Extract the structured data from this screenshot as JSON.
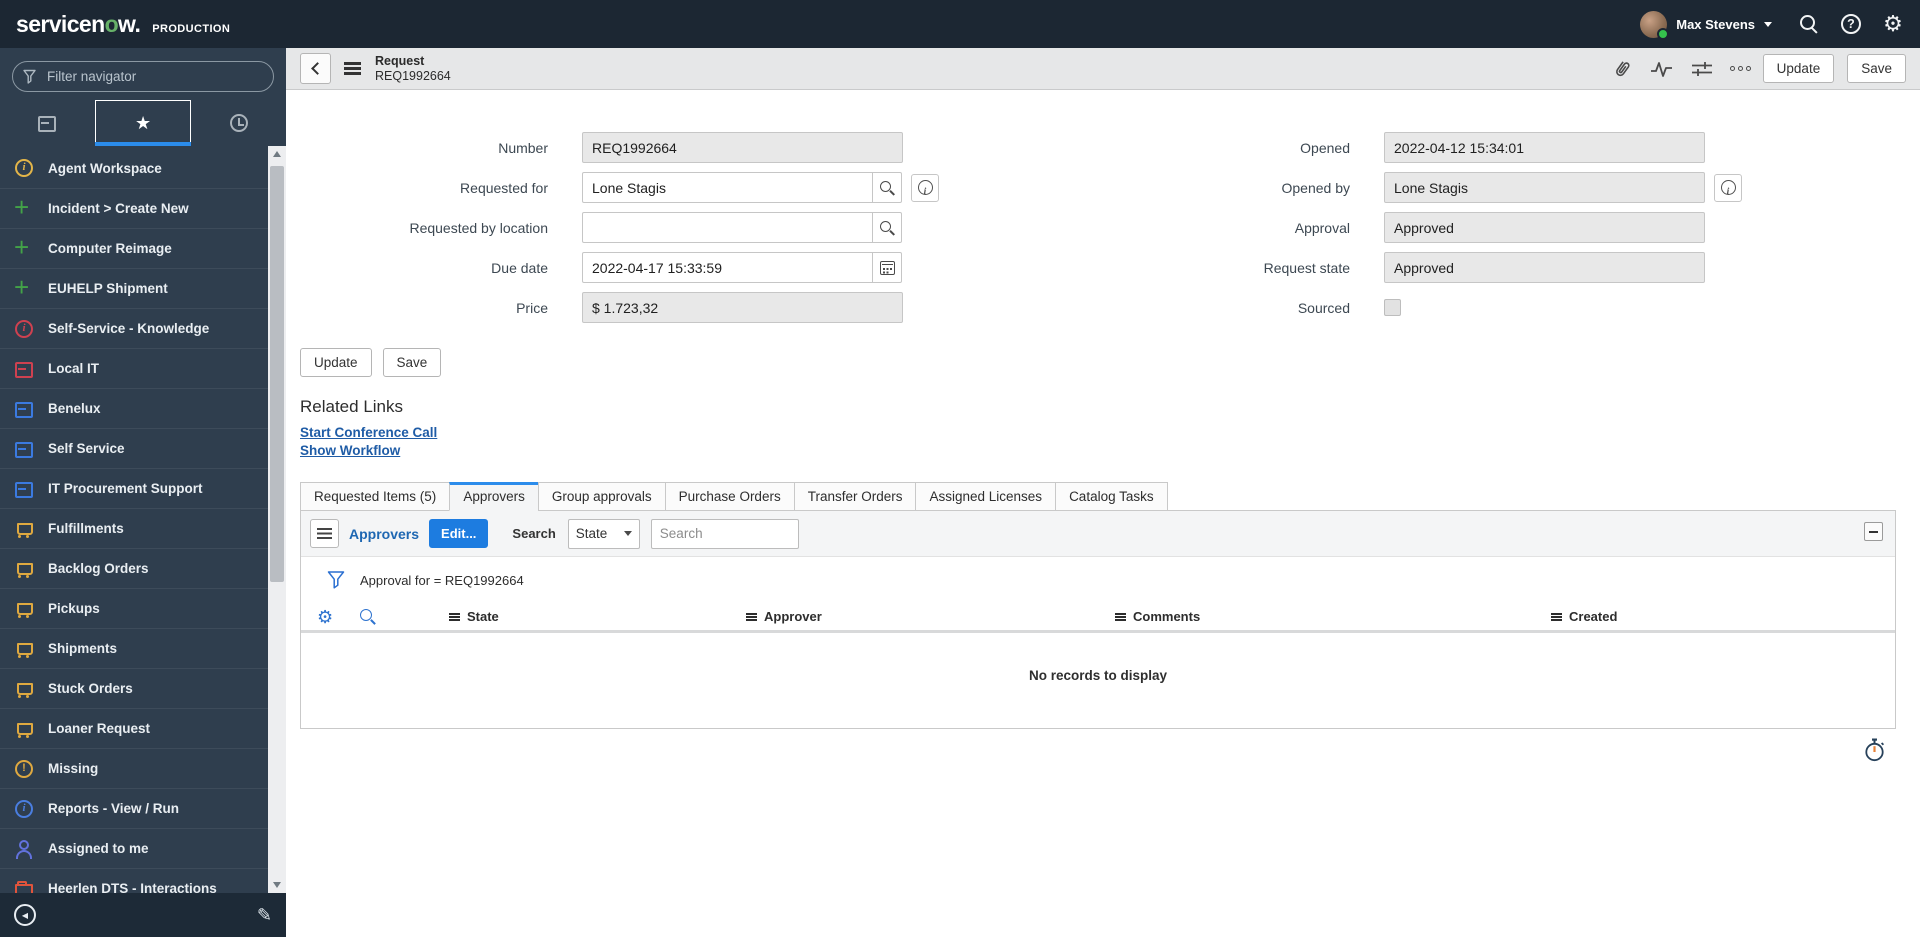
{
  "banner": {
    "brand_prefix": "servicen",
    "brand_accent": "o",
    "brand_suffix": "w.",
    "environment": "PRODUCTION",
    "user_name": "Max Stevens",
    "accent_green": "#67b168"
  },
  "sidebar": {
    "filter_placeholder": "Filter navigator",
    "items": [
      {
        "label": "Agent Workspace",
        "icon": "info-circle-icon",
        "color": "#e3b549"
      },
      {
        "label": "Incident > Create New",
        "icon": "plus-icon",
        "color": "#43a348"
      },
      {
        "label": "Computer Reimage",
        "icon": "plus-icon",
        "color": "#43a348"
      },
      {
        "label": "EUHELP Shipment",
        "icon": "plus-icon",
        "color": "#43a348"
      },
      {
        "label": "Self-Service - Knowledge",
        "icon": "info-circle-icon",
        "color": "#cf4150"
      },
      {
        "label": "Local IT",
        "icon": "box-icon",
        "color": "#cf4150"
      },
      {
        "label": "Benelux",
        "icon": "box-icon",
        "color": "#3b7ae0"
      },
      {
        "label": "Self Service",
        "icon": "box-icon",
        "color": "#3b7ae0"
      },
      {
        "label": "IT Procurement Support",
        "icon": "box-icon",
        "color": "#3b7ae0"
      },
      {
        "label": "Fulfillments",
        "icon": "cart-icon",
        "color": "#dfa940"
      },
      {
        "label": "Backlog Orders",
        "icon": "cart-icon",
        "color": "#dfa940"
      },
      {
        "label": "Pickups",
        "icon": "cart-icon",
        "color": "#dfa940"
      },
      {
        "label": "Shipments",
        "icon": "cart-icon",
        "color": "#dfa940"
      },
      {
        "label": "Stuck Orders",
        "icon": "cart-icon",
        "color": "#dfa940"
      },
      {
        "label": "Loaner Request",
        "icon": "cart-icon",
        "color": "#dfa940"
      },
      {
        "label": "Missing",
        "icon": "exclamation-circle-icon",
        "color": "#dfa940"
      },
      {
        "label": "Reports - View / Run",
        "icon": "info-circle-icon",
        "color": "#4a7ee0"
      },
      {
        "label": "Assigned to me",
        "icon": "person-icon",
        "color": "#6272dd"
      },
      {
        "label": "Heerlen DTS - Interactions",
        "icon": "folder-icon",
        "color": "#e0543c"
      }
    ]
  },
  "form_header": {
    "record_type": "Request",
    "record_number": "REQ1992664",
    "update_label": "Update",
    "save_label": "Save"
  },
  "form": {
    "left": [
      {
        "label": "Number",
        "value": "REQ1992664"
      },
      {
        "label": "Requested for",
        "value": "Lone Stagis"
      },
      {
        "label": "Requested by location",
        "value": ""
      },
      {
        "label": "Due date",
        "value": "2022-04-17 15:33:59"
      },
      {
        "label": "Price",
        "value": "$ 1.723,32"
      }
    ],
    "right": [
      {
        "label": "Opened",
        "value": "2022-04-12 15:34:01"
      },
      {
        "label": "Opened by",
        "value": "Lone Stagis"
      },
      {
        "label": "Approval",
        "value": "Approved"
      },
      {
        "label": "Request state",
        "value": "Approved"
      },
      {
        "label": "Sourced",
        "value": ""
      }
    ],
    "update_label": "Update",
    "save_label": "Save",
    "related_links_title": "Related Links",
    "related_links": [
      "Start Conference Call",
      "Show Workflow"
    ]
  },
  "tabs": [
    {
      "label": "Requested Items (5)"
    },
    {
      "label": "Approvers",
      "active": true
    },
    {
      "label": "Group approvals"
    },
    {
      "label": "Purchase Orders"
    },
    {
      "label": "Transfer Orders"
    },
    {
      "label": "Assigned Licenses"
    },
    {
      "label": "Catalog Tasks"
    }
  ],
  "list": {
    "title": "Approvers",
    "edit_label": "Edit...",
    "search_label": "Search",
    "search_column": "State",
    "search_placeholder": "Search",
    "breadcrumb": "Approval for = REQ1992664",
    "columns": [
      "State",
      "Approver",
      "Comments",
      "Created"
    ],
    "empty_message": "No records to display",
    "accent_blue": "#1d7ce0"
  }
}
